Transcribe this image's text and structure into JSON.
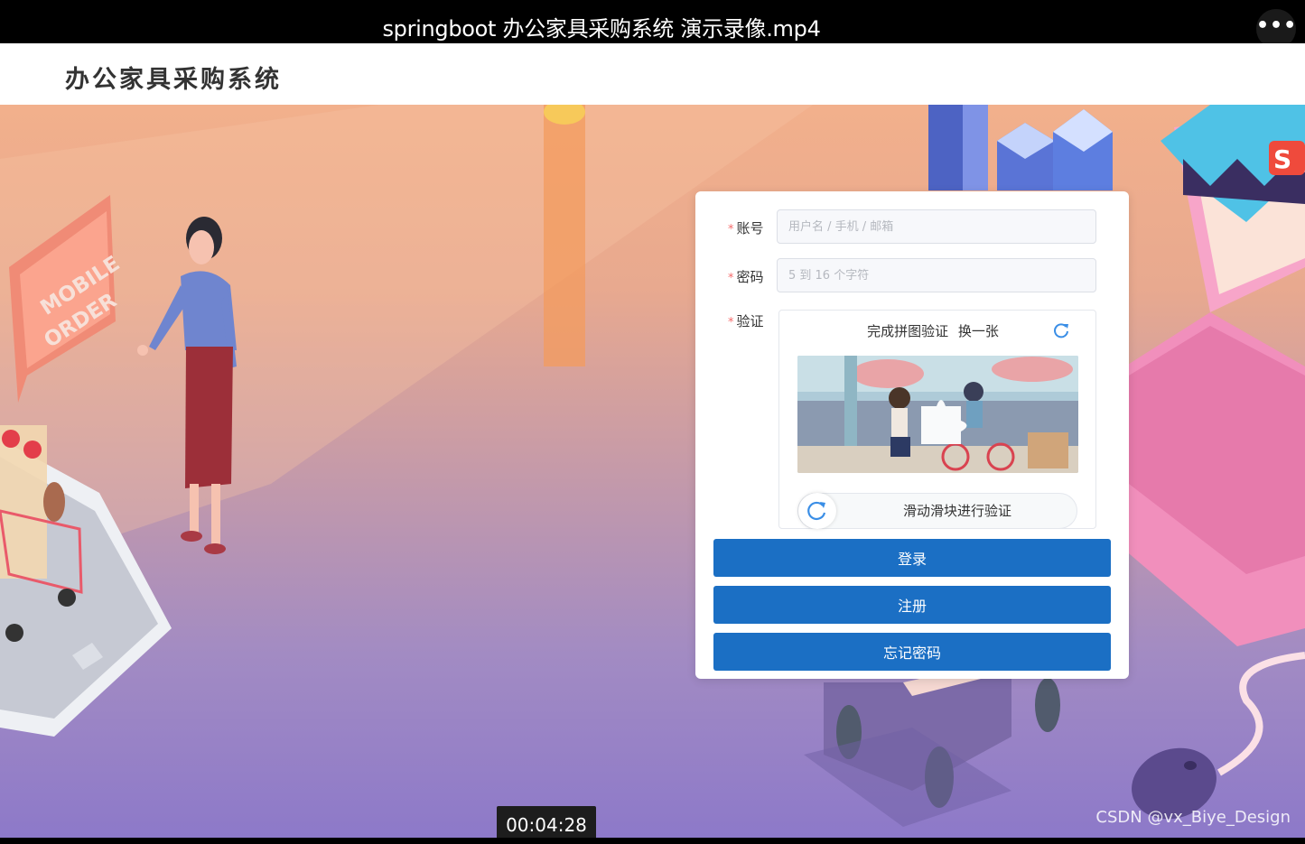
{
  "video": {
    "title": "springboot 办公家具采购系统 演示录像.mp4",
    "more_label": "•••",
    "timestamp": "00:04:28"
  },
  "app": {
    "title": "办公家具采购系统"
  },
  "scene": {
    "sign_text": "MOBILE ORDER",
    "sign_line1": "MOBILE",
    "sign_line2": "ORDER"
  },
  "login": {
    "account": {
      "label": "账号",
      "placeholder": "用户名 / 手机 / 邮箱",
      "value": ""
    },
    "password": {
      "label": "密码",
      "placeholder": "5 到 16 个字符",
      "value": ""
    },
    "verify": {
      "label": "验证",
      "prompt": "完成拼图验证",
      "change": "换一张",
      "slider_text": "滑动滑块进行验证"
    },
    "required_mark": "*",
    "buttons": {
      "login": "登录",
      "register": "注册",
      "forgot": "忘记密码"
    }
  },
  "watermark": "CSDN @vx_Biye_Design",
  "colors": {
    "primary": "#1b6fc4",
    "required": "#f56c6c",
    "sky_top": "#f2b08c",
    "sky_bottom": "#8d79c9"
  }
}
